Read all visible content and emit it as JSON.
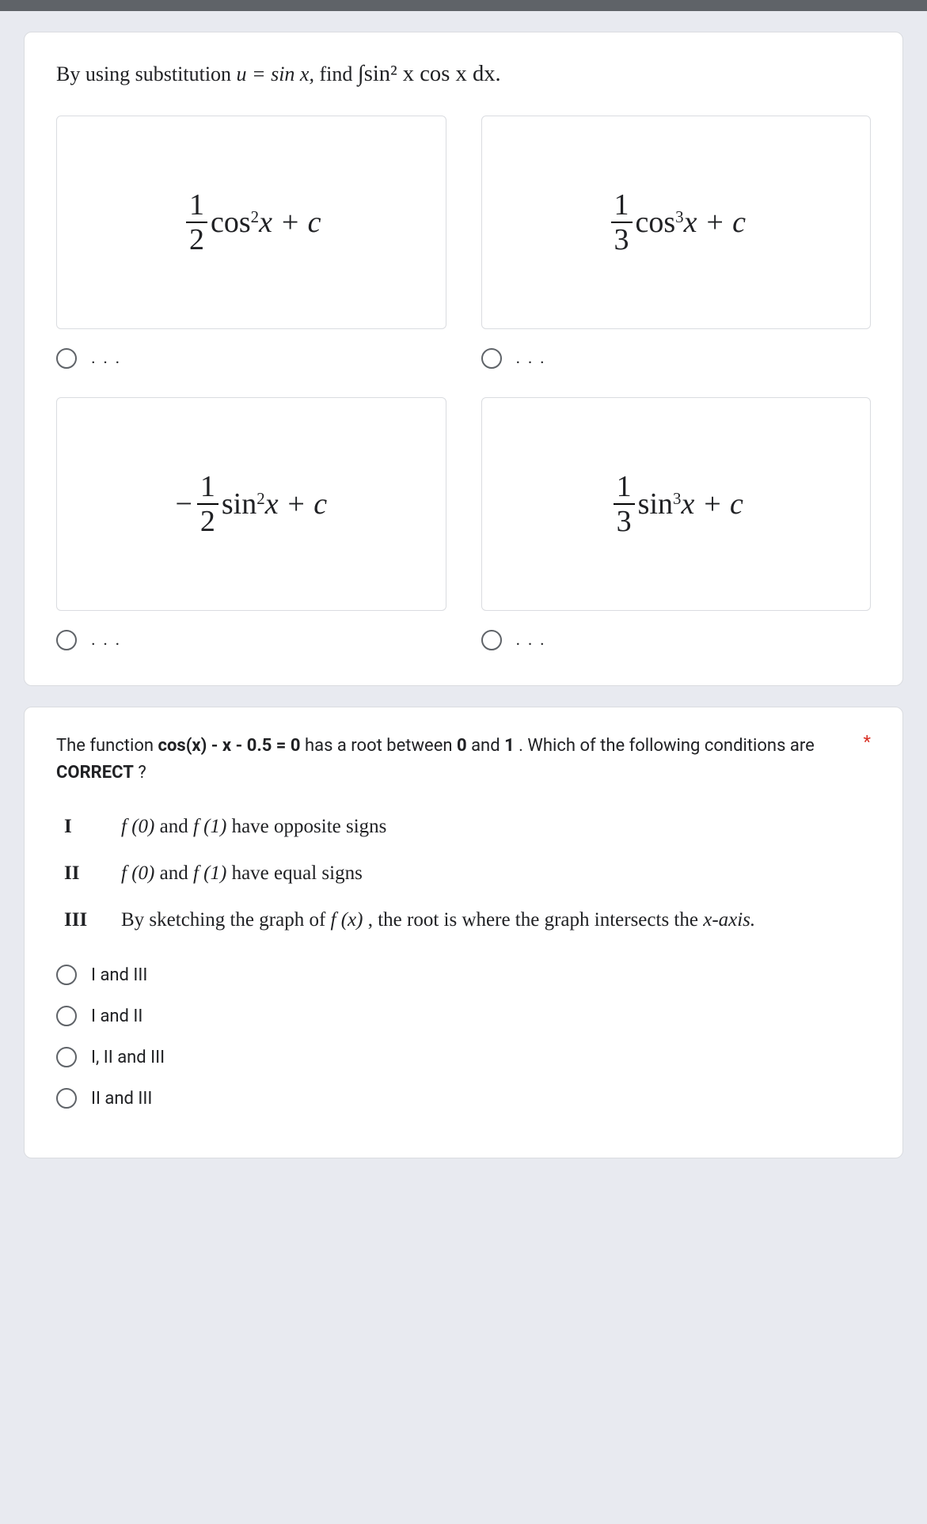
{
  "topbar": {},
  "q1": {
    "prompt_prefix": "By using substitution ",
    "prompt_sub": "u = sin x,",
    "prompt_mid": "  find  ",
    "prompt_integral": "∫sin² x cos x dx.",
    "options": [
      {
        "formula": {
          "sign": "",
          "num": "1",
          "den": "2",
          "fn": "cos",
          "pow": "2",
          "tail": " x + c"
        },
        "label": ". . ."
      },
      {
        "formula": {
          "sign": "",
          "num": "1",
          "den": "3",
          "fn": "cos",
          "pow": "3",
          "tail": " x + c"
        },
        "label": ". . ."
      },
      {
        "formula": {
          "sign": "−",
          "num": "1",
          "den": "2",
          "fn": "sin",
          "pow": "2",
          "tail": " x + c"
        },
        "label": ". . ."
      },
      {
        "formula": {
          "sign": "",
          "num": "1",
          "den": "3",
          "fn": "sin",
          "pow": "3",
          "tail": " x + c"
        },
        "label": ". . ."
      }
    ]
  },
  "q2": {
    "required_mark": "*",
    "text_1": "The function  ",
    "text_eq": "cos(x) - x - 0.5 = 0",
    "text_2": "  has a root between ",
    "bold0": "0",
    "text_3": " and ",
    "bold1": "1",
    "text_4": ". Which of the following conditions are ",
    "bold_correct": "CORRECT",
    "text_5": "?",
    "statements": [
      {
        "rn": "I",
        "pre": "",
        "f0": "f (0)",
        "mid1": " and ",
        "f1": "f (1)",
        "post": " have opposite signs"
      },
      {
        "rn": "II",
        "pre": "",
        "f0": "f (0)",
        "mid1": " and ",
        "f1": "f (1)",
        "post": " have equal signs"
      },
      {
        "rn": "III",
        "pre": "By sketching the graph of ",
        "f0": "f (x)",
        "mid1": ", the root is where the graph intersects the ",
        "f1": "",
        "post": "x-axis."
      }
    ],
    "choices": [
      "I and III",
      "I and II",
      "I, II and III",
      "II and III"
    ]
  }
}
